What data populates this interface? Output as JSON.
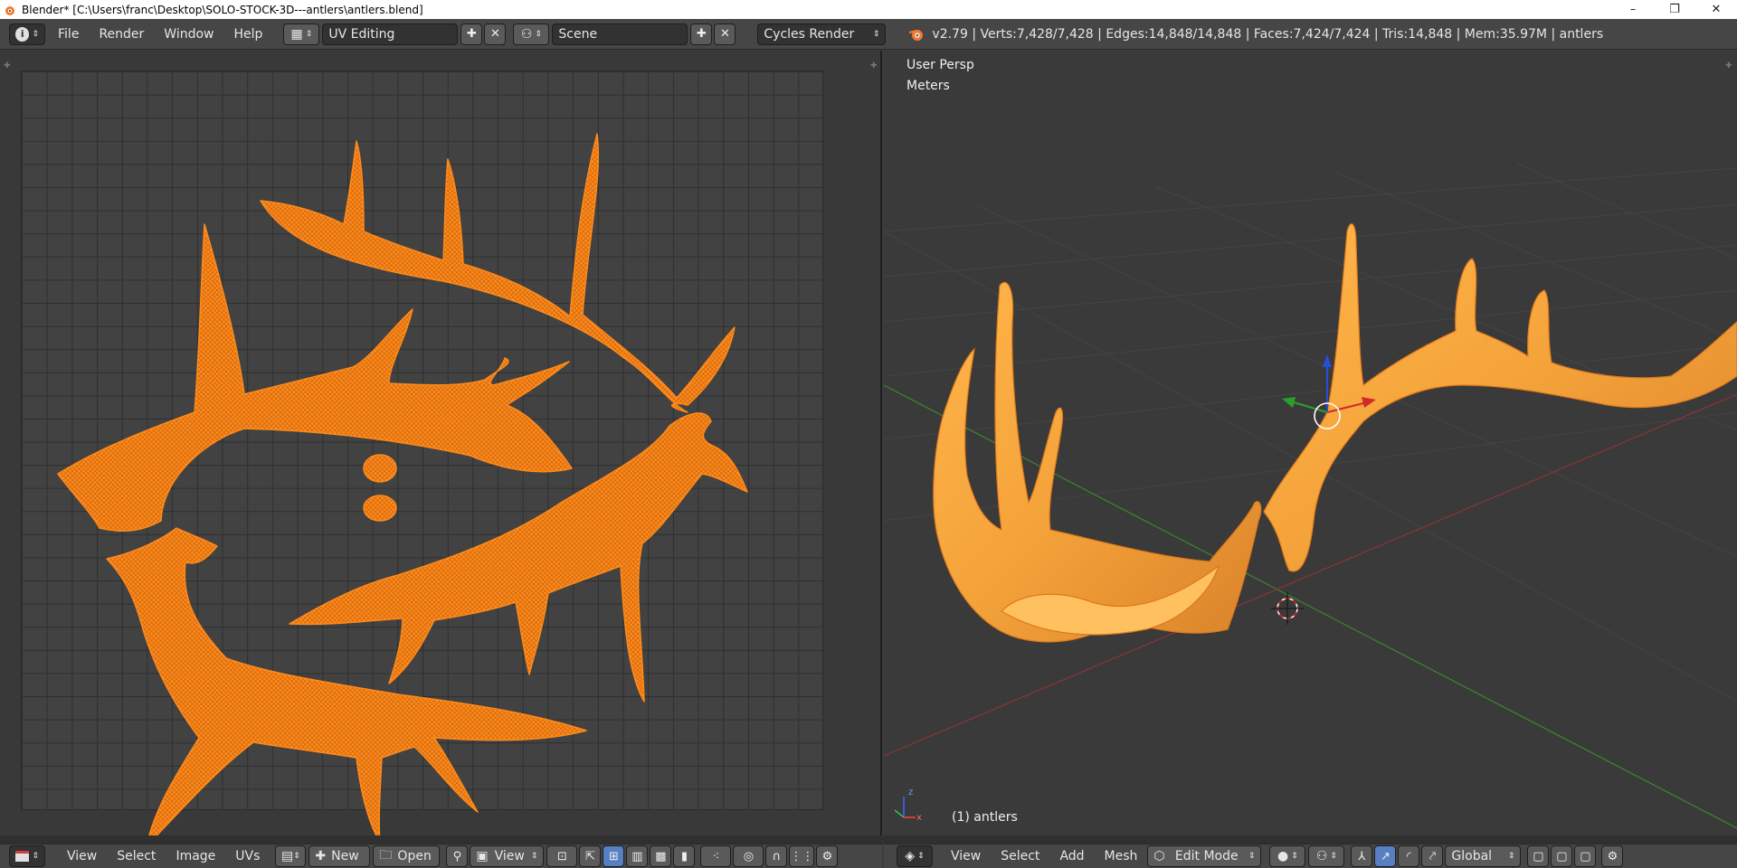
{
  "window": {
    "title": "Blender* [C:\\Users\\franc\\Desktop\\SOLO-STOCK-3D---antlers\\antlers.blend]",
    "min": "–",
    "max": "❐",
    "close": "✕"
  },
  "topbar": {
    "info_icon": "i",
    "menus": [
      "File",
      "Render",
      "Window",
      "Help"
    ],
    "layout": "UV Editing",
    "scene": "Scene",
    "engine": "Cycles Render",
    "stats": "v2.79 | Verts:7,428/7,428 | Edges:14,848/14,848 | Faces:7,424/7,424 | Tris:14,848 | Mem:35.97M | antlers"
  },
  "viewport": {
    "view_label": "User Persp",
    "units_label": "Meters",
    "object_label": "(1) antlers",
    "axis_x": "x",
    "axis_z": "z"
  },
  "uv_bottom": {
    "menus": [
      "View",
      "Select",
      "Image",
      "UVs"
    ],
    "new_label": "New",
    "open_label": "Open",
    "view_label": "View"
  },
  "vp_bottom": {
    "menus": [
      "View",
      "Select",
      "Add",
      "Mesh"
    ],
    "mode": "Edit Mode",
    "orientation": "Global"
  },
  "colors": {
    "accent": "#ff8a1a",
    "bg": "#393939"
  }
}
